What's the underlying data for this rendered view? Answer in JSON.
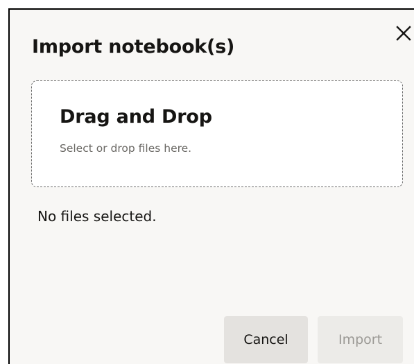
{
  "dialog": {
    "title": "Import notebook(s)",
    "close_icon": "close-icon"
  },
  "dropzone": {
    "title": "Drag and Drop",
    "subtitle": "Select or drop files here."
  },
  "status": {
    "text": "No files selected."
  },
  "actions": {
    "cancel_label": "Cancel",
    "import_label": "Import"
  }
}
